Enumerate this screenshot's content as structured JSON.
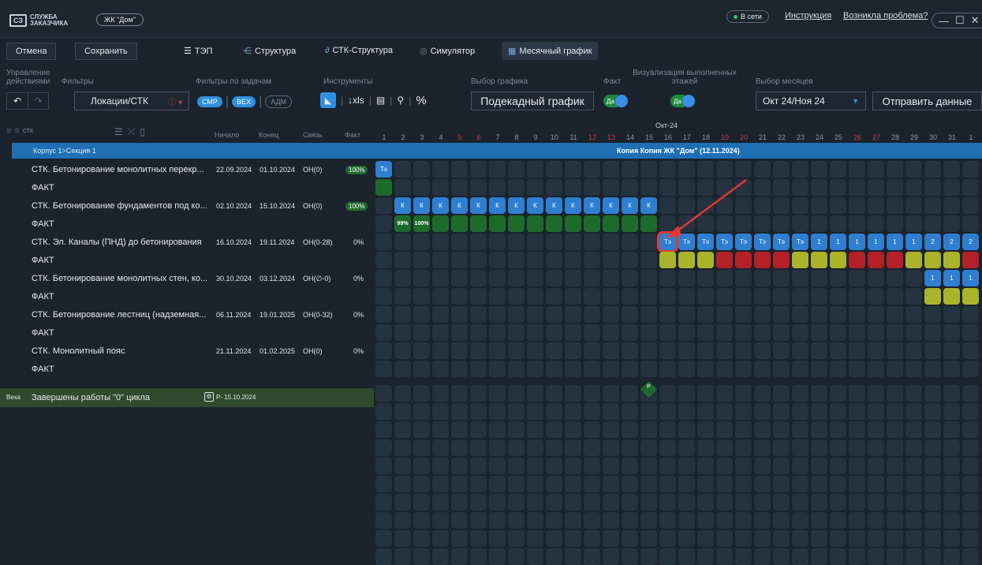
{
  "titlebar": {
    "logo_mark": "СЗ",
    "logo_text": "СЛУЖБА ЗАКАЗЧИКА",
    "project": "ЖК \"Дом\"",
    "status": "В сети",
    "instruction": "Инструкция",
    "problem": "Возникла проблема?"
  },
  "toolbar": {
    "cancel": "Отмена",
    "save": "Сохранить",
    "tabs": [
      "ТЭП",
      "Структура",
      "СТК-Структура",
      "Симулятор",
      "Месячный график"
    ]
  },
  "controls": {
    "manage_label": "Управление действиями",
    "filters_label": "Фильтры",
    "task_filters_label": "Фильтры по задачам",
    "tools_label": "Инструменты",
    "schedule_label": "Выбор графика",
    "fact_label": "Факт",
    "vis_label": "Визуализация выполненных этажей",
    "months_label": "Выбор месяцев",
    "filter_value": "Локации/СТК",
    "task_pills": [
      "СМР",
      "ВЕХ",
      "АДМ"
    ],
    "xls": "↓xls",
    "percent": "%",
    "schedule_value": "Подекадный график",
    "toggle_on": "Да",
    "months_value": "Окт 24/Ноя 24",
    "send": "Отправить данные"
  },
  "grid_header": {
    "stk": "СТК",
    "start": "Начало",
    "end": "Конец",
    "link": "Связь",
    "fact": "Факт",
    "month": "Окт-24",
    "days": [
      "1",
      "2",
      "3",
      "4",
      "5",
      "6",
      "7",
      "8",
      "9",
      "10",
      "11",
      "12",
      "13",
      "14",
      "15",
      "16",
      "17",
      "18",
      "19",
      "20",
      "21",
      "22",
      "23",
      "24",
      "25",
      "26",
      "27",
      "28",
      "29",
      "30",
      "31",
      "1"
    ],
    "red_days": [
      "5",
      "6",
      "12",
      "13",
      "19",
      "20",
      "26",
      "27"
    ]
  },
  "group_row": {
    "label": "Корпус 1>Секция 1",
    "title": "Копия Копия ЖК \"Дом\" (12.11.2024)"
  },
  "tasks": [
    {
      "name": "СТК. Бетонирование монолитных перекр...",
      "start": "22.09.2024",
      "end": "01.10.2024",
      "link": "ОН(0)",
      "fact": "100%"
    },
    {
      "name": "ФАКТ"
    },
    {
      "name": "СТК. Бетонирование фундаментов под ко...",
      "start": "02.10.2024",
      "end": "15.10.2024",
      "link": "ОН(0)",
      "fact": "100%"
    },
    {
      "name": "ФАКТ"
    },
    {
      "name": "СТК. Эл. Каналы (ПНД) до бетонирования",
      "start": "16.10.2024",
      "end": "19.11.2024",
      "link": "ОН(0-28)",
      "fact": "0%"
    },
    {
      "name": "ФАКТ"
    },
    {
      "name": "СТК. Бетонирование монолитных стен, ко...",
      "start": "30.10.2024",
      "end": "03.12.2024",
      "link": "ОН(∅-0)",
      "fact": "0%"
    },
    {
      "name": "ФАКТ"
    },
    {
      "name": "СТК. Бетонирование лестниц (надземная...",
      "start": "06.11.2024",
      "end": "19.01.2025",
      "link": "ОН(0-32)",
      "fact": "0%"
    },
    {
      "name": "ФАКТ"
    },
    {
      "name": "СТК. Монолитный пояс",
      "start": "21.11.2024",
      "end": "01.02.2025",
      "link": "ОН(0)",
      "fact": "0%"
    },
    {
      "name": "ФАКТ"
    }
  ],
  "milestone": {
    "tag": "Веха",
    "name": "Завершены работы \"0\" цикла",
    "date": "Р- 15.10.2024",
    "marker": "Р"
  },
  "cell_labels": {
    "te": "Тэ",
    "k": "К",
    "one": "1",
    "two": "2",
    "p99": "99%",
    "p100": "100%"
  },
  "colors": {
    "accent_blue": "#2e7fd1",
    "done_green": "#1d6b2b",
    "warn_yellow": "#a9b42a",
    "late_red": "#b32028",
    "highlight": "#e03a2f"
  }
}
